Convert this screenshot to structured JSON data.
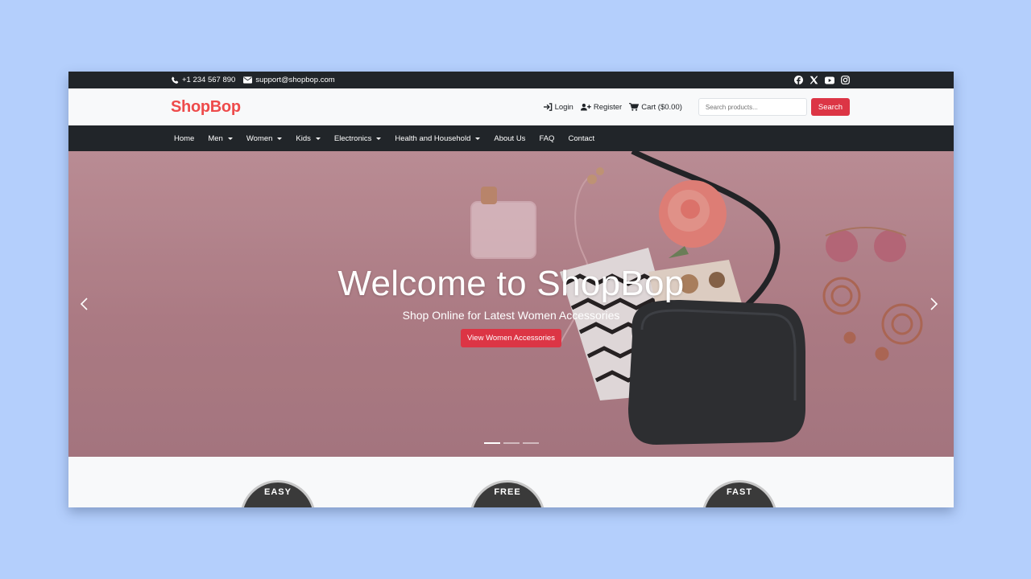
{
  "topbar": {
    "phone": "+1 234 567 890",
    "email": "support@shopbop.com",
    "social": [
      "facebook-icon",
      "x-icon",
      "youtube-icon",
      "instagram-icon"
    ]
  },
  "header": {
    "logo": "ShopBop",
    "login": "Login",
    "register": "Register",
    "cart": "Cart ($0.00)",
    "search_placeholder": "Search products...",
    "search_button": "Search"
  },
  "nav": {
    "items": [
      {
        "label": "Home",
        "dropdown": false
      },
      {
        "label": "Men",
        "dropdown": true
      },
      {
        "label": "Women",
        "dropdown": true
      },
      {
        "label": "Kids",
        "dropdown": true
      },
      {
        "label": "Electronics",
        "dropdown": true
      },
      {
        "label": "Health and Household",
        "dropdown": true
      },
      {
        "label": "About Us",
        "dropdown": false
      },
      {
        "label": "FAQ",
        "dropdown": false
      },
      {
        "label": "Contact",
        "dropdown": false
      }
    ]
  },
  "hero": {
    "title": "Welcome to ShopBop",
    "subtitle": "Shop Online for Latest Women Accessories",
    "button": "View Women Accessories",
    "slides": 3,
    "active_slide": 1
  },
  "features": [
    {
      "label": "EASY"
    },
    {
      "label": "FREE"
    },
    {
      "label": "FAST"
    }
  ],
  "colors": {
    "brand": "#ee4b4b",
    "accent": "#dc3545",
    "dark": "#212529",
    "page_bg": "#b4cffc"
  }
}
